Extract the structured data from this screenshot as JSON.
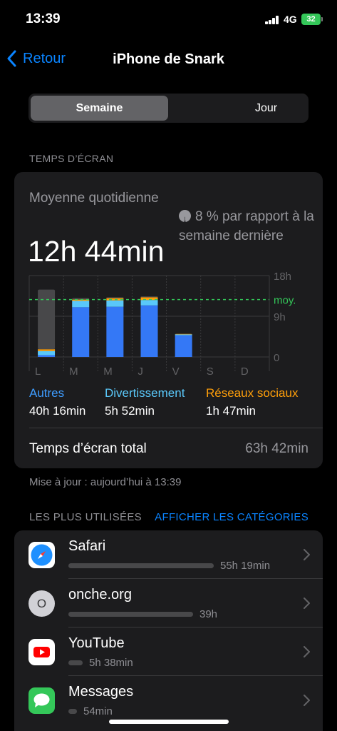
{
  "status": {
    "time": "13:39",
    "network": "4G",
    "battery": "32"
  },
  "nav": {
    "back_label": "Retour",
    "title": "iPhone de Snark"
  },
  "segments": {
    "week": "Semaine",
    "day": "Jour"
  },
  "section_screen_time": "TEMPS D’ÉCRAN",
  "summary": {
    "avg_label": "Moyenne quotidienne",
    "avg_value": "12h 44min",
    "compare_text": "8 % par rapport à la semaine dernière"
  },
  "chart_data": {
    "type": "bar",
    "categories": [
      "L",
      "M",
      "M",
      "J",
      "V",
      "S",
      "D"
    ],
    "series": [
      {
        "name": "Autres",
        "color": "#3478f6",
        "values": [
          0.4,
          11.0,
          11.1,
          11.4,
          4.8,
          0,
          0
        ]
      },
      {
        "name": "Divertissement",
        "color": "#5ac8fa",
        "values": [
          0.9,
          1.4,
          1.4,
          1.2,
          0.2,
          0,
          0
        ]
      },
      {
        "name": "Réseaux sociaux",
        "color": "#ff9f0a",
        "values": [
          0.4,
          0.3,
          0.5,
          0.6,
          0.1,
          0,
          0
        ]
      },
      {
        "values": [
          13.2,
          0.3,
          0.2,
          0.2,
          0,
          0,
          0
        ]
      }
    ],
    "other_color": "#48484a",
    "ylim": [
      0,
      18
    ],
    "yticks": [
      "18h",
      "9h",
      "0"
    ],
    "ytick_values": [
      18,
      9,
      0
    ],
    "average": 12.7,
    "average_label": "moy.",
    "average_color": "#34c759"
  },
  "categories": [
    {
      "label": "Autres",
      "value": "40h 16min",
      "color": "#3e9cfe"
    },
    {
      "label": "Divertissement",
      "value": "5h 52min",
      "color": "#5ac8fa"
    },
    {
      "label": "Réseaux sociaux",
      "value": "1h 47min",
      "color": "#ff9f0a"
    }
  ],
  "total": {
    "label": "Temps d’écran total",
    "value": "63h 42min"
  },
  "updated": "Mise à jour : aujourd’hui à 13:39",
  "most_used": {
    "header": "LES PLUS UTILISÉES",
    "action": "AFFICHER LES CATÉGORIES"
  },
  "apps": [
    {
      "name": "Safari",
      "usage": "55h 19min",
      "fraction": 1.0,
      "icon": "safari-icon"
    },
    {
      "name": "onche.org",
      "usage": "39h",
      "fraction": 0.86,
      "icon": "onche-icon",
      "icon_letter": "O"
    },
    {
      "name": "YouTube",
      "usage": "5h 38min",
      "fraction": 0.1,
      "icon": "youtube-icon"
    },
    {
      "name": "Messages",
      "usage": "54min",
      "fraction": 0.05,
      "icon": "messages-icon"
    }
  ]
}
